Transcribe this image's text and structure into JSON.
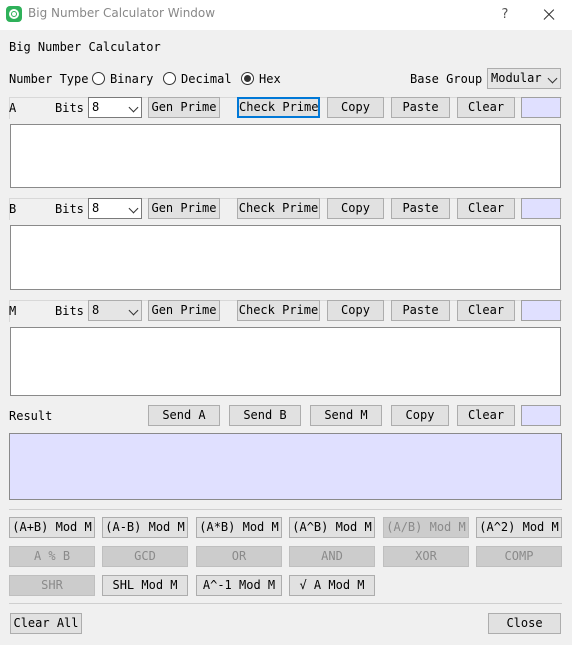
{
  "window": {
    "title": "Big Number Calculator Window",
    "help": "?"
  },
  "header": {
    "title": "Big Number Calculator"
  },
  "number_type": {
    "label": "Number Type",
    "options": [
      "Binary",
      "Decimal",
      "Hex"
    ],
    "selected": "Hex"
  },
  "base_group": {
    "label": "Base Group",
    "value": "Modular"
  },
  "rows": [
    {
      "name": "A",
      "bits_label": "Bits",
      "bits": "8",
      "gen": "Gen Prime",
      "check": "Check Prime",
      "copy": "Copy",
      "paste": "Paste",
      "clear": "Clear",
      "value": ""
    },
    {
      "name": "B",
      "bits_label": "Bits",
      "bits": "8",
      "gen": "Gen Prime",
      "check": "Check Prime",
      "copy": "Copy",
      "paste": "Paste",
      "clear": "Clear",
      "value": ""
    },
    {
      "name": "M",
      "bits_label": "Bits",
      "bits": "8",
      "gen": "Gen Prime",
      "check": "Check Prime",
      "copy": "Copy",
      "paste": "Paste",
      "clear": "Clear",
      "value": ""
    }
  ],
  "result": {
    "label": "Result",
    "send_a": "Send A",
    "send_b": "Send B",
    "send_m": "Send M",
    "copy": "Copy",
    "clear": "Clear",
    "value": ""
  },
  "ops": {
    "row1": [
      "(A+B) Mod M",
      "(A-B) Mod M",
      "(A*B) Mod M",
      "(A^B) Mod M",
      "(A/B) Mod M",
      "(A^2) Mod M"
    ],
    "row2": [
      "A % B",
      "GCD",
      "OR",
      "AND",
      "XOR",
      "COMP"
    ],
    "row3": [
      "SHR",
      "SHL Mod M",
      "A^-1 Mod M",
      "√ A Mod M"
    ]
  },
  "footer": {
    "clear_all": "Clear All",
    "close": "Close"
  },
  "colors": {
    "swatch": "#e0e0ff",
    "focus": "#0078d7",
    "app_icon": "#2fb15a"
  }
}
